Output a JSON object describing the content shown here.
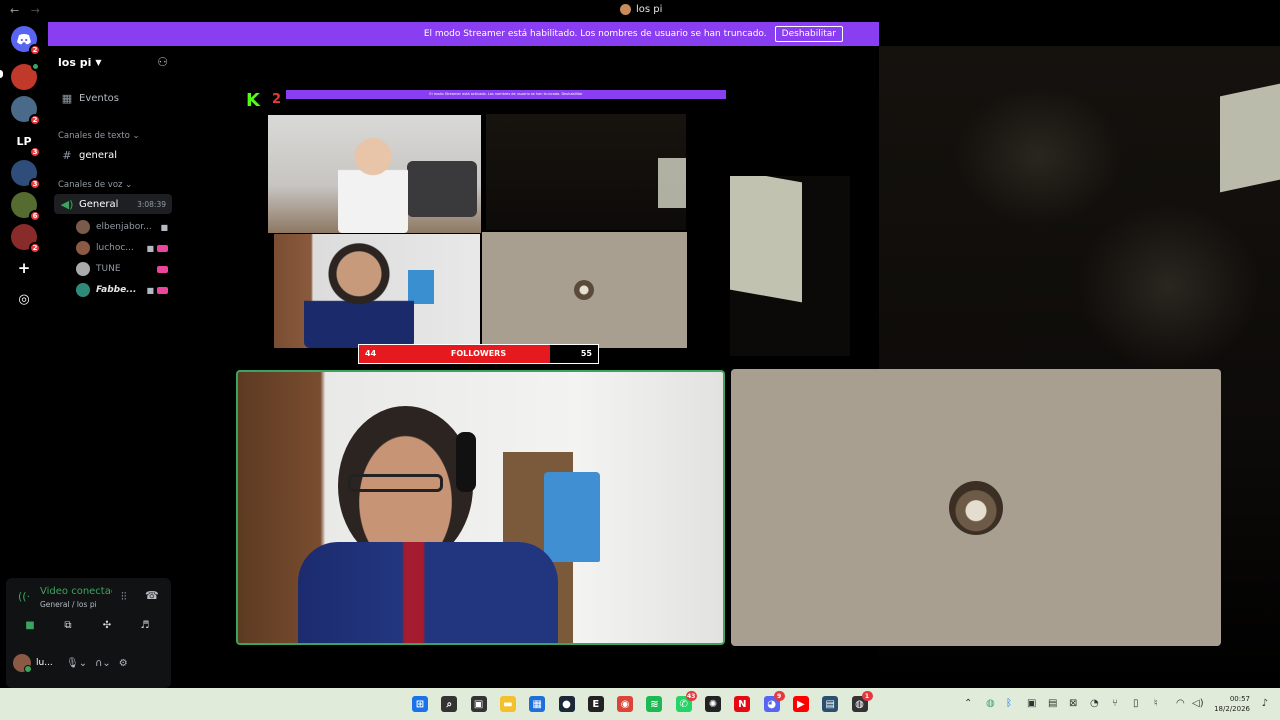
{
  "window": {
    "title": "los pi",
    "nav_back": "←",
    "nav_forward": "→"
  },
  "banner": {
    "text": "El modo Streamer está habilitado. Los nombres de usuario se han truncado.",
    "button": "Deshabilitar"
  },
  "rail": {
    "servers": [
      {
        "label": "",
        "badge": "2",
        "color": "#5865f2"
      },
      {
        "label": "",
        "badge": "",
        "color": "#c0392b"
      },
      {
        "label": "",
        "badge": "2",
        "color": "#4a6a8a"
      },
      {
        "label": "LP",
        "badge": "3",
        "color": "#000000"
      },
      {
        "label": "",
        "badge": "3",
        "color": "#2e4d7a"
      },
      {
        "label": "",
        "badge": "6",
        "color": "#556b2f"
      },
      {
        "label": "",
        "badge": "2",
        "color": "#8a2b2b"
      }
    ],
    "add_icon": "+",
    "discover_icon": "◎"
  },
  "sidebar": {
    "guild_name": "los pi",
    "events": "Eventos",
    "text_category": "Canales de texto",
    "text_channel": "general",
    "voice_category": "Canales de voz",
    "voice_channel": "General",
    "voice_timer": "3:08:39",
    "members": [
      {
        "name": "elbenjabor...",
        "live": false,
        "bold": false,
        "color": "#7a5a4a"
      },
      {
        "name": "luchoc...",
        "live": true,
        "bold": false,
        "color": "#8a5a44"
      },
      {
        "name": "TUNE",
        "live": true,
        "bold": false,
        "color": "#aaaaaa"
      },
      {
        "name": "Fabbe...",
        "live": true,
        "bold": true,
        "color": "#2e8b7a"
      }
    ]
  },
  "voice_panel": {
    "status": "Video conectado",
    "location": "General / los pi",
    "username": "lu..."
  },
  "stream": {
    "nested_banner": "El modo Streamer está activado. Los nombres de usuario se han truncado. Deshabilitar",
    "followers_label": "FOLLOWERS",
    "followers_current": "44",
    "followers_goal": "55",
    "followers_progress": 0.8
  },
  "taskbar": {
    "apps": [
      {
        "name": "windows-start",
        "glyph": "⊞",
        "color": "#1a73e8"
      },
      {
        "name": "search",
        "glyph": "⌕",
        "color": "#333333"
      },
      {
        "name": "task-view",
        "glyph": "▣",
        "color": "#333333"
      },
      {
        "name": "file-explorer",
        "glyph": "▬",
        "color": "#f4c02e"
      },
      {
        "name": "store",
        "glyph": "▦",
        "color": "#1e6fd9"
      },
      {
        "name": "steam",
        "glyph": "●",
        "color": "#1b2838"
      },
      {
        "name": "epic-games",
        "glyph": "E",
        "color": "#222222"
      },
      {
        "name": "chrome",
        "glyph": "◉",
        "color": "#db4437"
      },
      {
        "name": "spotify",
        "glyph": "≋",
        "color": "#1db954"
      },
      {
        "name": "whatsapp",
        "glyph": "✆",
        "color": "#25d366",
        "badge": "43"
      },
      {
        "name": "chatgpt",
        "glyph": "✺",
        "color": "#222222"
      },
      {
        "name": "netflix",
        "glyph": "N",
        "color": "#e50914"
      },
      {
        "name": "discord",
        "glyph": "◕",
        "color": "#5865f2",
        "badge": "9"
      },
      {
        "name": "youtube",
        "glyph": "▶",
        "color": "#ff0000"
      },
      {
        "name": "monitor",
        "glyph": "▤",
        "color": "#2b4f6e"
      },
      {
        "name": "app-extra",
        "glyph": "◍",
        "color": "#333333",
        "badge": "1"
      }
    ],
    "time": "00:57",
    "date": "18/2/2026"
  }
}
